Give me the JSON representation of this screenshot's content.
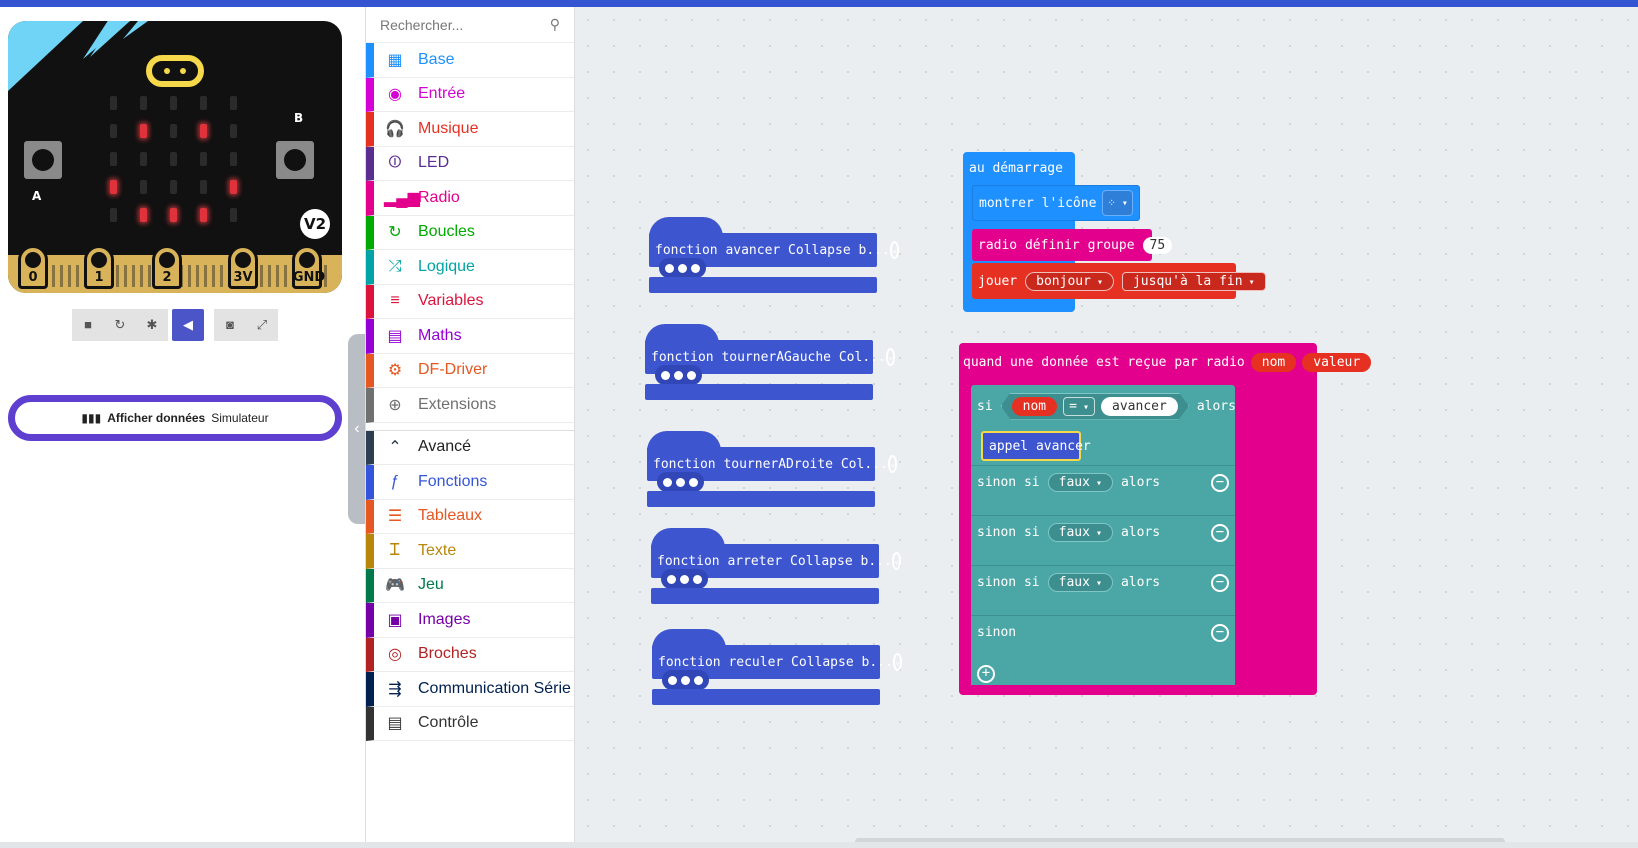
{
  "search": {
    "placeholder": "Rechercher..."
  },
  "toolbox": {
    "categories": [
      {
        "label": "Base",
        "color": "#1e90ff",
        "icon": "grid-icon",
        "glyph": "▦"
      },
      {
        "label": "Entrée",
        "color": "#d400d4",
        "icon": "input-circle-icon",
        "glyph": "◉"
      },
      {
        "label": "Musique",
        "color": "#e63022",
        "icon": "headphones-icon",
        "glyph": "🎧"
      },
      {
        "label": "LED",
        "color": "#5c2d91",
        "icon": "toggle-icon",
        "glyph": "⏼"
      },
      {
        "label": "Radio",
        "color": "#e3008c",
        "icon": "signal-icon",
        "glyph": "▂▄▆"
      },
      {
        "label": "Boucles",
        "color": "#00aa00",
        "icon": "refresh-icon",
        "glyph": "↻"
      },
      {
        "label": "Logique",
        "color": "#00a4a6",
        "icon": "shuffle-icon",
        "glyph": "⤮"
      },
      {
        "label": "Variables",
        "color": "#dc143c",
        "icon": "list-icon",
        "glyph": "≡"
      },
      {
        "label": "Maths",
        "color": "#9400d3",
        "icon": "calculator-icon",
        "glyph": "▤"
      },
      {
        "label": "DF-Driver",
        "color": "#e65722",
        "icon": "gear-icon",
        "glyph": "⚙"
      },
      {
        "label": "Extensions",
        "color": "#707070",
        "icon": "plus-circle-icon",
        "glyph": "⊕"
      }
    ],
    "advanced": [
      {
        "label": "Avancé",
        "color": "#2c3e50",
        "icon": "chevron-up-icon",
        "glyph": "⌃"
      },
      {
        "label": "Fonctions",
        "color": "#3455db",
        "icon": "function-icon",
        "glyph": "ƒ"
      },
      {
        "label": "Tableaux",
        "color": "#e65722",
        "icon": "list-bullets-icon",
        "glyph": "☰"
      },
      {
        "label": "Texte",
        "color": "#b8860b",
        "icon": "text-icon",
        "glyph": "Ꮖ"
      },
      {
        "label": "Jeu",
        "color": "#007a4b",
        "icon": "gamepad-icon",
        "glyph": "🎮"
      },
      {
        "label": "Images",
        "color": "#7600a8",
        "icon": "image-icon",
        "glyph": "▣"
      },
      {
        "label": "Broches",
        "color": "#b22222",
        "icon": "target-icon",
        "glyph": "◎"
      },
      {
        "label": "Communication Série",
        "color": "#002050",
        "icon": "usb-icon",
        "glyph": "⇶"
      },
      {
        "label": "Contrôle",
        "color": "#333333",
        "icon": "server-icon",
        "glyph": "▤"
      }
    ]
  },
  "simulator": {
    "pins": [
      "0",
      "1",
      "2",
      "3V",
      "GND"
    ],
    "button_a": "A",
    "button_b": "B",
    "version": "V2",
    "show_data_bold": "Afficher données",
    "show_data_rest": "Simulateur"
  },
  "workspace": {
    "functions": [
      "fonction avancer Collapse b...",
      "fonction tournerAGauche Col...",
      "fonction tournerADroite Col...",
      "fonction arreter Collapse b...",
      "fonction reculer Collapse b..."
    ],
    "on_start": {
      "hat": "au démarrage",
      "show_icon": "montrer l'icône",
      "radio_group": "radio définir groupe",
      "group_value": "75",
      "play": "jouer",
      "melody": "bonjour",
      "until": "jusqu'à la fin"
    },
    "on_radio": {
      "hat": "quand une donnée est reçue par radio",
      "param1": "nom",
      "param2": "valeur",
      "if": "si",
      "var": "nom",
      "op": "=",
      "string": "avancer",
      "then": "alors",
      "call": "appel avancer",
      "elseif": "sinon si",
      "false": "faux",
      "else": "sinon"
    }
  },
  "colors": {
    "functions": "#3d55cf",
    "radio": "#e3008c",
    "basic": "#1e90ff",
    "music": "#e63022",
    "logic": "#4ba6a6"
  }
}
